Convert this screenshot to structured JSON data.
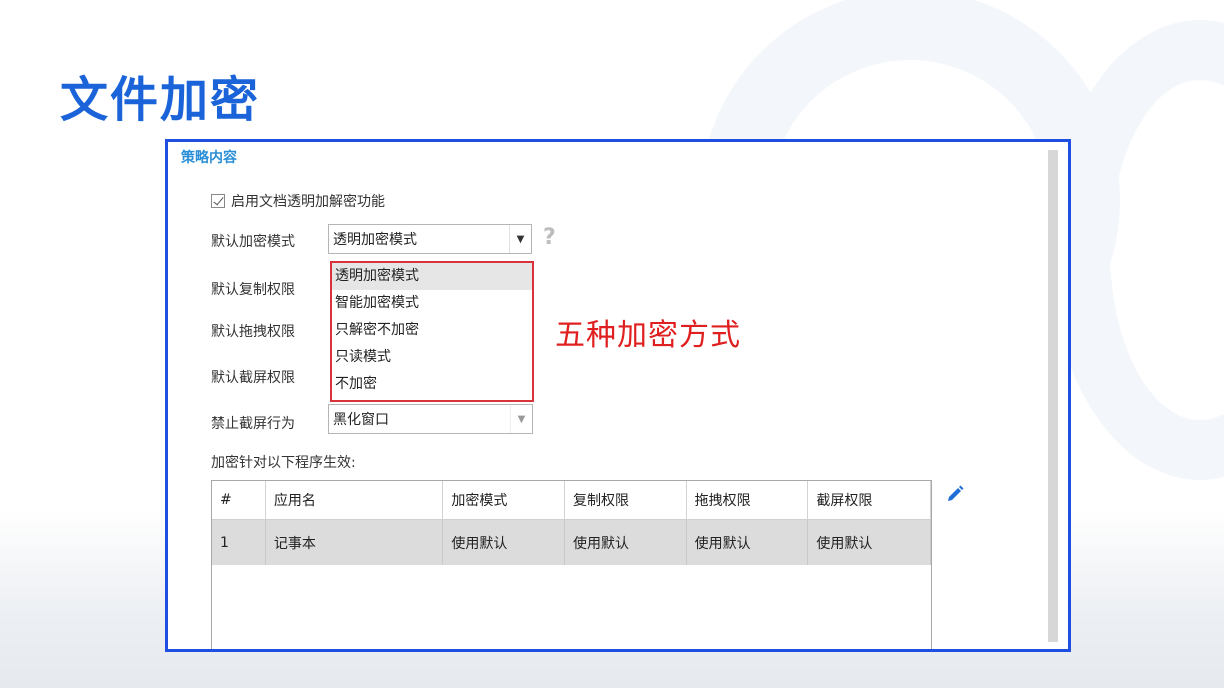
{
  "slide": {
    "title": "文件加密"
  },
  "panel": {
    "section_title": "策略内容",
    "enable_checkbox": {
      "label": "启用文档透明加解密功能",
      "checked": true
    },
    "default_mode": {
      "label": "默认加密模式",
      "value": "透明加密模式"
    },
    "copy_perm": {
      "label": "默认复制权限"
    },
    "drag_perm": {
      "label": "默认拖拽权限"
    },
    "screenshot_perm": {
      "label": "默认截屏权限"
    },
    "block_screenshot": {
      "label": "禁止截屏行为",
      "value": "黑化窗口"
    },
    "help_icon": "question-mark-icon",
    "dropdown_options": [
      "透明加密模式",
      "智能加密模式",
      "只解密不加密",
      "只读模式",
      "不加密"
    ],
    "callout": "五种加密方式",
    "apply_label": "加密针对以下程序生效:",
    "table": {
      "headers": [
        "#",
        "应用名",
        "加密模式",
        "复制权限",
        "拖拽权限",
        "截屏权限"
      ],
      "rows": [
        [
          "1",
          "记事本",
          "使用默认",
          "使用默认",
          "使用默认",
          "使用默认"
        ]
      ]
    },
    "edit_icon": "pencil-icon",
    "colors": {
      "accent": "#1a63d8",
      "frame": "#1f4fe0",
      "highlight": "#d8323a",
      "callout": "#e02020"
    }
  }
}
